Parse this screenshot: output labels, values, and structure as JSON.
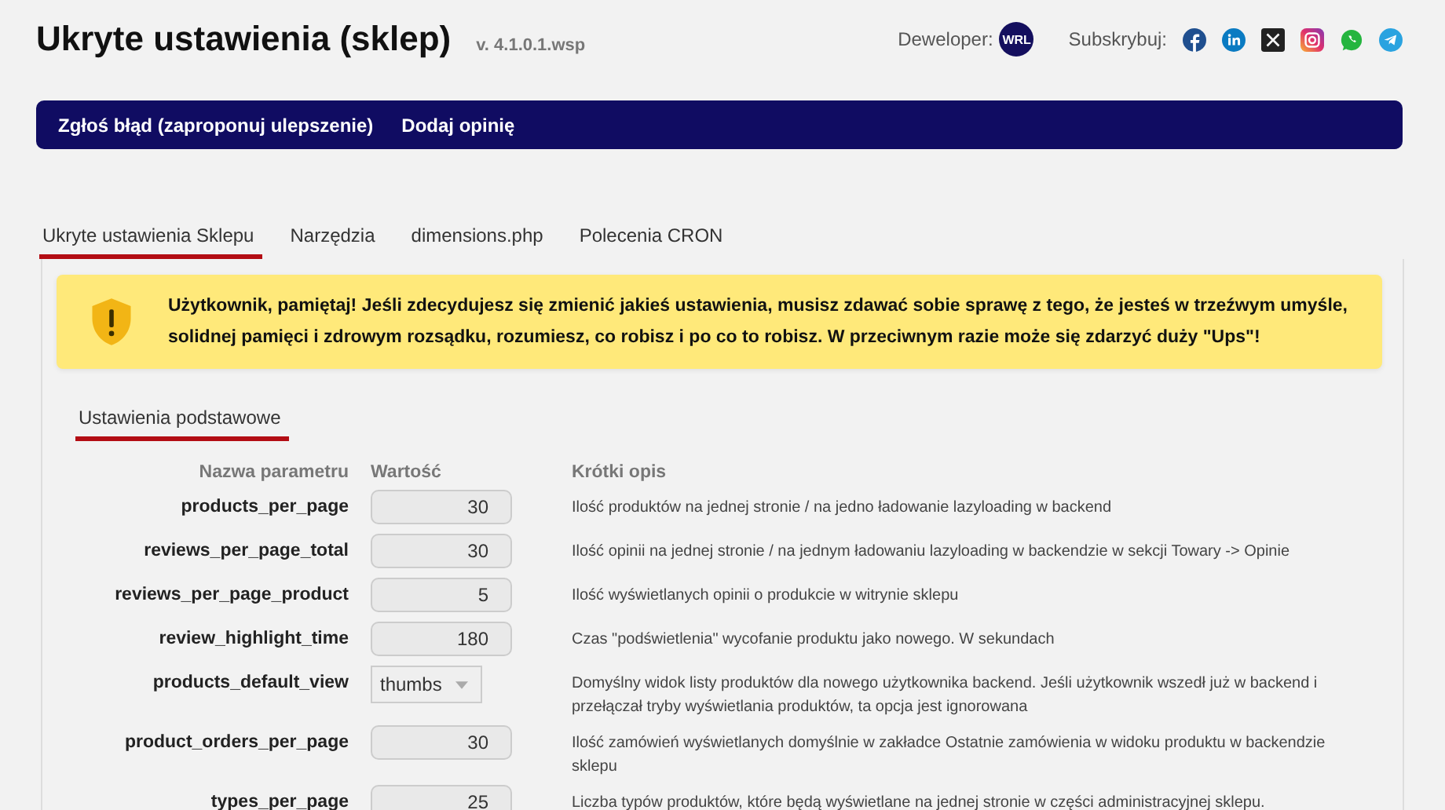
{
  "header": {
    "title": "Ukryte ustawienia (sklep)",
    "version": "v. 4.1.0.1.wsp",
    "developer_label": "Deweloper:",
    "developer_badge": "WRL",
    "subscribe_label": "Subskrybuj:"
  },
  "nav": [
    "Zgłoś błąd (zaproponuj ulepszenie)",
    "Dodaj opinię"
  ],
  "tabs": [
    {
      "label": "Ukryte ustawienia Sklepu",
      "selected": true
    },
    {
      "label": "Narzędzia",
      "selected": false
    },
    {
      "label": "dimensions.php",
      "selected": false
    },
    {
      "label": "Polecenia CRON",
      "selected": false
    }
  ],
  "warning": "Użytkownik, pamiętaj! Jeśli zdecydujesz się zmienić jakieś ustawienia, musisz zdawać sobie sprawę z tego, że jesteś w trzeźwym umyśle, solidnej pamięci i zdrowym rozsądku, rozumiesz, co robisz i po co to robisz. W przeciwnym razie może się zdarzyć duży \"Ups\"!",
  "subtabs": [
    {
      "label": "Ustawienia podstawowe",
      "selected": true
    }
  ],
  "table": {
    "columns": [
      "Nazwa parametru",
      "Wartość",
      "Krótki opis"
    ],
    "rows": [
      {
        "name": "products_per_page",
        "kind": "number",
        "value": "30",
        "description": "Ilość produktów na jednej stronie / na jedno ładowanie lazyloading w backend"
      },
      {
        "name": "reviews_per_page_total",
        "kind": "number",
        "value": "30",
        "description": "Ilość opinii na jednej stronie / na jednym ładowaniu lazyloading w backendzie w sekcji Towary -> Opinie"
      },
      {
        "name": "reviews_per_page_product",
        "kind": "number",
        "value": "5",
        "description": "Ilość wyświetlanych opinii o produkcie w witrynie sklepu"
      },
      {
        "name": "review_highlight_time",
        "kind": "number",
        "value": "180",
        "description": "Czas \"podświetlenia\" wycofanie produktu jako nowego. W sekundach"
      },
      {
        "name": "products_default_view",
        "kind": "select",
        "value": "thumbs",
        "description": "Domyślny widok listy produktów dla nowego użytkownika backend. Jeśli użytkownik wszedł już w backend i przełączał tryby wyświetlania produktów, ta opcja jest ignorowana"
      },
      {
        "name": "product_orders_per_page",
        "kind": "number",
        "value": "30",
        "description": "Ilość zamówień wyświetlanych domyślnie w zakładce Ostatnie zamówienia w widoku produktu w backendzie sklepu"
      },
      {
        "name": "types_per_page",
        "kind": "number",
        "value": "25",
        "description": "Liczba typów produktów, które będą wyświetlane na jednej stronie w części administracyjnej sklepu."
      }
    ]
  }
}
